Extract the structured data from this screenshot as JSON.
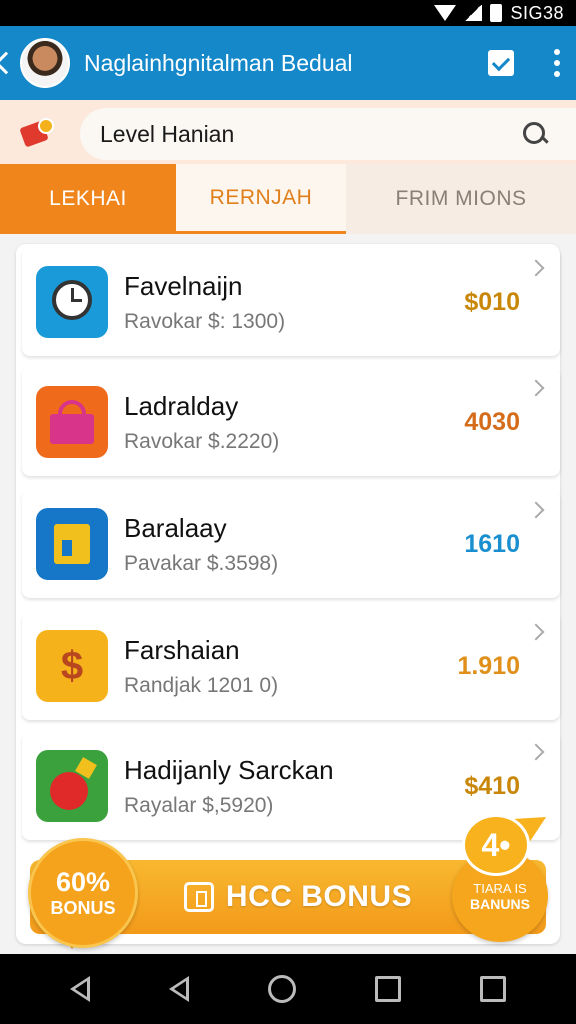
{
  "status_bar": {
    "time": "SIG38"
  },
  "app_bar": {
    "title": "Naglainhgnitalman Bedual"
  },
  "search": {
    "value": "Level Hanian"
  },
  "tabs": [
    {
      "label": "LEKHAI"
    },
    {
      "label": "RERNJAH"
    },
    {
      "label": "FRIM MIONS"
    }
  ],
  "items": [
    {
      "title": "Favelnaijn",
      "subtitle": "Ravokar $: 1300)",
      "value": "$010",
      "value_color": "#c9870a",
      "icon": "clock-icon"
    },
    {
      "title": "Ladralday",
      "subtitle": "Ravokar $.2220)",
      "value": "4030",
      "value_color": "#d46c1a",
      "icon": "shopping-basket-icon"
    },
    {
      "title": "Baralaay",
      "subtitle": "Pavakar $.3598)",
      "value": "1610",
      "value_color": "#1a8fd0",
      "icon": "folder-app-icon"
    },
    {
      "title": "Farshaian",
      "subtitle": "Randjak 1201 0)",
      "value": "1.910",
      "value_color": "#e0901a",
      "icon": "dollar-icon"
    },
    {
      "title": "Hadijanly Sarckan",
      "subtitle": "Rayalar $,5920)",
      "value": "$410",
      "value_color": "#c9870a",
      "icon": "bomb-icon"
    }
  ],
  "bonus": {
    "badge_left_percent": "60%",
    "badge_left_label": "BONUS",
    "bar_text": "HCC BONUS",
    "bubble_text": "4•",
    "badge_right_line1": "TIARA IS",
    "badge_right_line2": "BANUNS"
  }
}
